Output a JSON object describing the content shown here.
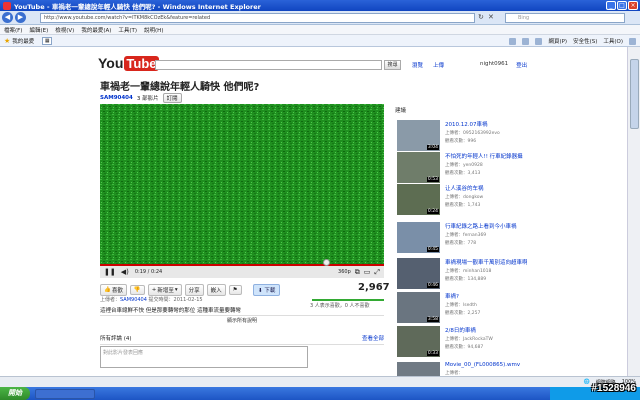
{
  "window": {
    "title": "YouTube - 車禍老一輩總說年輕人騎快 他們呢? - Windows Internet Explorer"
  },
  "address": {
    "url": "http://www.youtube.com/watch?v=lTKM8kCOzEk&feature=related",
    "search_placeholder": "Bing"
  },
  "menu": [
    "檔案(F)",
    "編輯(E)",
    "檢視(V)",
    "我的最愛(A)",
    "工具(T)",
    "說明(H)"
  ],
  "favorites": {
    "label": "我的最愛",
    "commands": [
      "網頁(P)",
      "安全性(S)",
      "工具(O)"
    ]
  },
  "youtube": {
    "search_button": "搜尋",
    "links": [
      "瀏覽",
      "上傳"
    ],
    "username": "night0961",
    "signout": "登出"
  },
  "video": {
    "title": "車禍老一輩總說年輕人騎快 他們呢?",
    "channel": "SAM90404",
    "video_count": "3 部影片",
    "subscribe": "訂閱",
    "time": "0:19 / 0:24",
    "quality": "360p",
    "views": "2,967",
    "likes_text": "3 人表示喜歡，0 人不喜歡",
    "uploader_prefix": "上傳者：",
    "uploader": "SAM90404",
    "upload_date": "提交時間：2011-02-15",
    "description": "這裡台車總鮮不快 但是那要轉彎的那位 這種車流量要轉彎",
    "show_more": "顯示所有說明"
  },
  "actions": {
    "like": "喜歡",
    "add_to": "新增至",
    "share": "分享",
    "embed": "嵌入",
    "download": "下載"
  },
  "comments": {
    "header": "所有評論 (4)",
    "see_all": "查看全部",
    "placeholder": "對此影片發表回應"
  },
  "sidebar": {
    "title": "建議",
    "items": [
      {
        "title": "2010.12.07車禍",
        "meta": "上傳者：0952163992evo",
        "views": "觀看次數：996",
        "dur": "3:04"
      },
      {
        "title": "不怕死的年輕人!! 行車紀錄器攝",
        "meta": "上傳者：yen0928",
        "views": "觀看次數：3,413",
        "dur": "0:53"
      },
      {
        "title": "让人溪谷的车祸",
        "meta": "上傳者：dongkow",
        "views": "觀看次數：1,743",
        "dur": "0:24"
      },
      {
        "title": "行車紀錄之路上看到今小車禍",
        "meta": "上傳者：fernan369",
        "views": "觀看次數：778",
        "dur": "0:45"
      },
      {
        "title": "車禍現場一觀車千萬別這向超車啊!",
        "meta": "上傳者：minhan1018",
        "views": "觀看次數：134,889",
        "dur": "0:46"
      },
      {
        "title": "車禍?",
        "meta": "上傳者：lsedth",
        "views": "觀看次數：2,257",
        "dur": "3:58"
      },
      {
        "title": "2/8日的車禍",
        "meta": "上傳者：JackRockaTW",
        "views": "觀看次數：94,687",
        "dur": "0:33"
      },
      {
        "title": "Movie_00_(FL000865).wmv",
        "meta": "上傳者：",
        "views": "",
        "dur": ""
      }
    ]
  },
  "status": {
    "zone": "網際網路",
    "zoom": "100%"
  },
  "taskbar": {
    "start": "開始"
  },
  "watermark": "#1528946"
}
